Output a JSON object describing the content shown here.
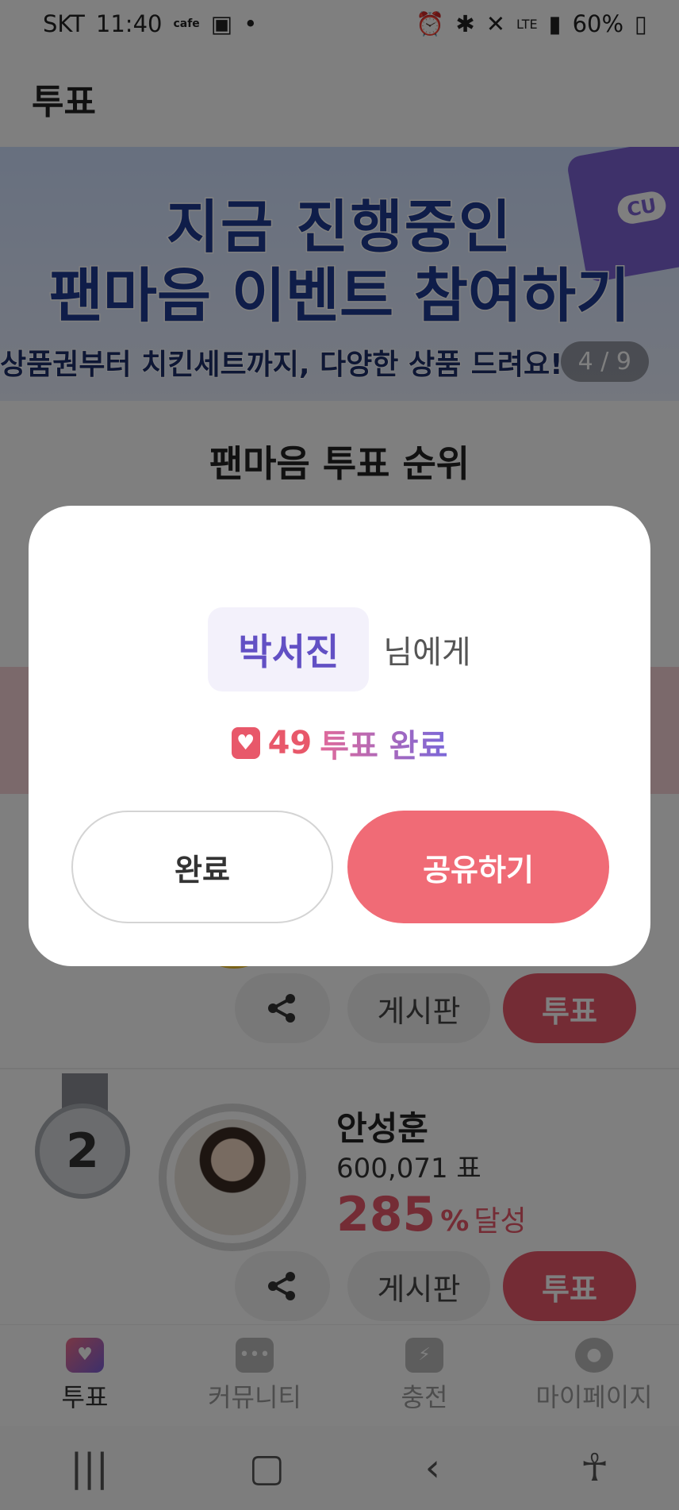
{
  "status_bar": {
    "carrier": "SKT",
    "time": "11:40",
    "cafe_label": "cafe",
    "network": "LTE",
    "battery": "60%"
  },
  "header": {
    "title": "투표"
  },
  "banner": {
    "line1": "지금 진행중인",
    "line2": "팬마음 이벤트 참여하기",
    "line3": "상품권부터 치킨세트까지, 다양한 상품 드려요!",
    "card_brand": "CU",
    "counter": "4 / 9"
  },
  "ranking": {
    "section_title": "팬마음 투표 순위",
    "actions": {
      "board_label": "게시판",
      "vote_label": "투표"
    },
    "rank2": {
      "rank": "2",
      "name": "안성훈",
      "votes": "600,071 표",
      "percent": "285",
      "percent_sign": "%",
      "achieve_label": "달성"
    }
  },
  "bottom_nav": [
    {
      "label": "투표",
      "icon": "heart-vote-icon",
      "active": true
    },
    {
      "label": "커뮤니티",
      "icon": "chat-icon",
      "active": false
    },
    {
      "label": "충전",
      "icon": "charge-icon",
      "active": false
    },
    {
      "label": "마이페이지",
      "icon": "person-icon",
      "active": false
    }
  ],
  "modal": {
    "recipient_name": "박서진",
    "recipient_suffix": "님에게",
    "vote_count": "49",
    "vote_complete_text": "투표 완료",
    "done_label": "완료",
    "share_label": "공유하기"
  },
  "colors": {
    "accent": "#e8586a",
    "share_button": "#f06b76",
    "recipient": "#6250c4"
  }
}
